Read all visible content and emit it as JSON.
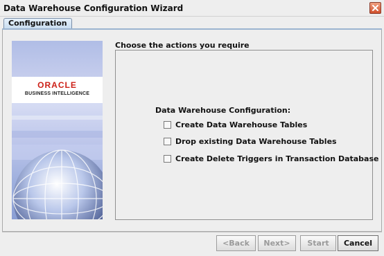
{
  "window": {
    "title": "Data Warehouse Configuration Wizard"
  },
  "tabs": [
    {
      "label": "Configuration"
    }
  ],
  "banner": {
    "logo_brand": "ORACLE",
    "logo_product": "BUSINESS INTELLIGENCE"
  },
  "main": {
    "prompt": "Choose the actions you require",
    "group_label": "Data Warehouse Configuration:",
    "options": [
      {
        "label": "Create Data Warehouse Tables",
        "checked": false
      },
      {
        "label": "Drop existing Data Warehouse Tables",
        "checked": false
      },
      {
        "label": "Create Delete Triggers in Transaction Database",
        "checked": false
      }
    ]
  },
  "buttons": {
    "back": "<Back",
    "next": "Next>",
    "start": "Start",
    "cancel": "Cancel"
  },
  "colors": {
    "oracle_red": "#cc1f16",
    "tab_accent": "#9bb4d0",
    "close_button": "#d0502c"
  }
}
